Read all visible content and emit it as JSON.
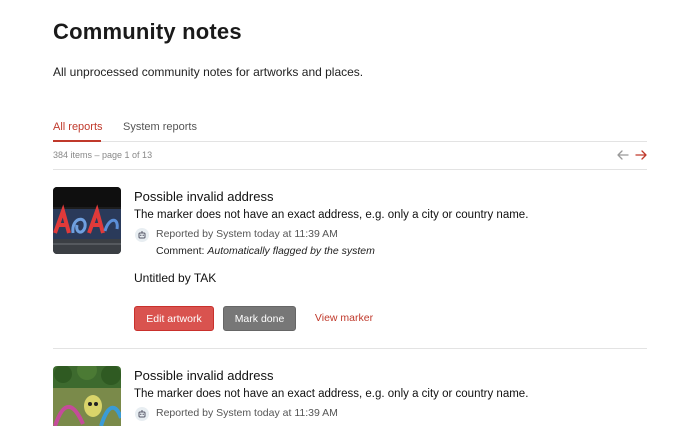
{
  "header": {
    "title": "Community notes",
    "subtitle": "All unprocessed community notes for artworks and places."
  },
  "tabs": [
    {
      "label": "All reports",
      "active": true
    },
    {
      "label": "System reports",
      "active": false
    }
  ],
  "pager": {
    "summary": "384 items – page 1 of 13",
    "prev_icon": "arrow-left-icon",
    "next_icon": "arrow-right-icon"
  },
  "colors": {
    "accent": "#c0392b",
    "edit_button": "#d9534f",
    "done_button": "#777777"
  },
  "notes": [
    {
      "title": "Possible invalid address",
      "description": "The marker does not have an exact address, e.g. only a city or country name.",
      "reported": "Reported by System today at 11:39 AM",
      "comment_prefix": "Comment: ",
      "comment": "Automatically flagged by the system",
      "artwork": "Untitled by TAK",
      "actions": {
        "edit": "Edit artwork",
        "done": "Mark done",
        "view": "View marker"
      }
    },
    {
      "title": "Possible invalid address",
      "description": "The marker does not have an exact address, e.g. only a city or country name.",
      "reported": "Reported by System today at 11:39 AM"
    }
  ]
}
